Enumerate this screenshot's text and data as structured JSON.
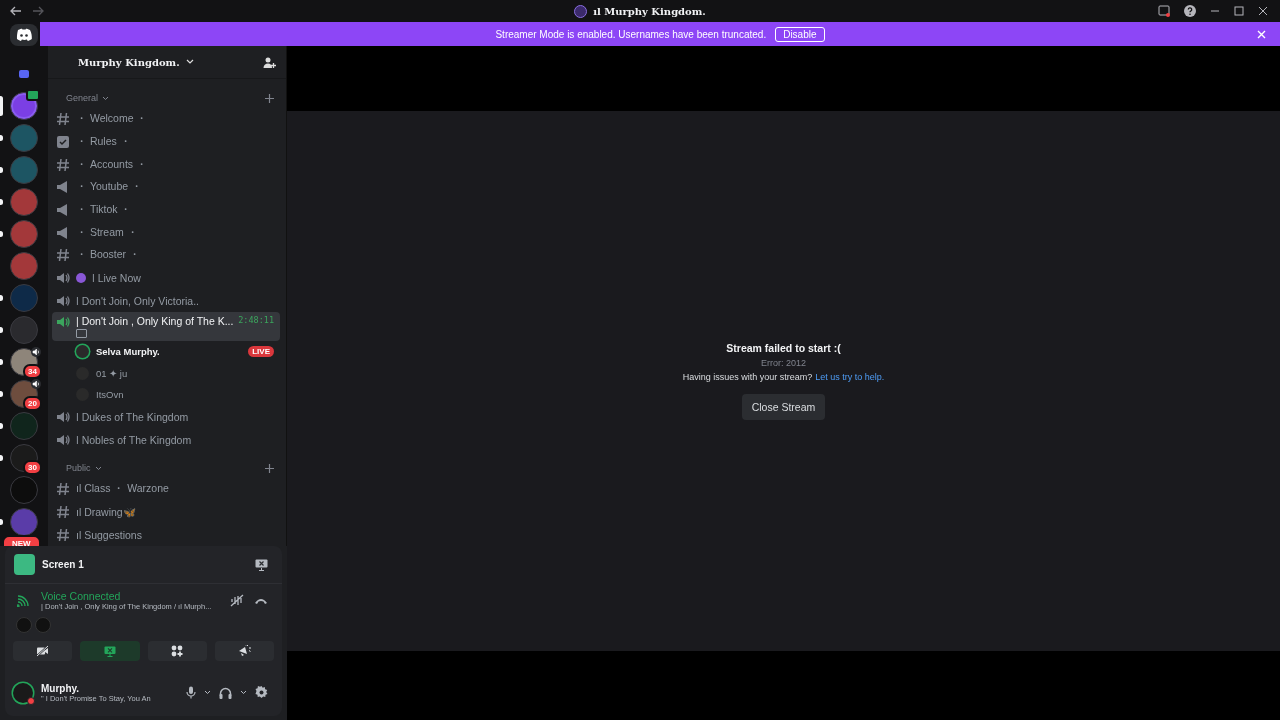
{
  "titlebar": {
    "title": "ıl Murphy Kingdom."
  },
  "banner": {
    "text": "Streamer Mode is enabled. Usernames have been truncated.",
    "button": "Disable"
  },
  "servers": [
    {
      "color": "#7b3fe4",
      "selected": true,
      "chat_badge": true
    },
    {
      "color": "#1d5563",
      "selected": false,
      "unread": true
    },
    {
      "color": "#1d5563",
      "selected": false,
      "unread": true
    },
    {
      "color": "#a3383a",
      "selected": false,
      "unread": true
    },
    {
      "color": "#a3383a",
      "selected": false,
      "unread": true
    },
    {
      "color": "#a3383a",
      "selected": false
    },
    {
      "color": "#0e2a48",
      "selected": false,
      "unread": true
    },
    {
      "color": "#2a2a2e",
      "selected": false,
      "unread": true
    },
    {
      "color": "#8e857a",
      "selected": false,
      "unread": true,
      "speaker": true,
      "badge": "34"
    },
    {
      "color": "#6e4d3e",
      "selected": false,
      "unread": true,
      "speaker": true,
      "badge": "20"
    },
    {
      "color": "#10251c",
      "selected": false,
      "unread": true
    },
    {
      "color": "#1b1b1b",
      "selected": false,
      "unread": true,
      "badge": "30"
    },
    {
      "color": "#0d0d0d",
      "selected": false
    },
    {
      "color": "#5a3ca8",
      "selected": false,
      "unread": true,
      "badge": "NEW"
    }
  ],
  "server_name": "Murphy Kingdom.",
  "categories": [
    {
      "name": "General",
      "channels": [
        {
          "kind": "text",
          "name": "・ Welcome ・",
          "selected": false
        },
        {
          "kind": "rules",
          "name": "・ Rules ・",
          "selected": false
        },
        {
          "kind": "text",
          "name": "・ Accounts ・",
          "selected": false
        },
        {
          "kind": "announcement",
          "name": "・ Youtube ・",
          "selected": false
        },
        {
          "kind": "announcement",
          "name": "・ Tiktok ・",
          "selected": false
        },
        {
          "kind": "announcement",
          "name": "・ Stream ・",
          "selected": false
        },
        {
          "kind": "text",
          "name": "・ Booster ・",
          "selected": false
        },
        {
          "kind": "voice",
          "name": "ǀ Live Now",
          "selected": false,
          "dot": true
        },
        {
          "kind": "voice",
          "name": "ǀ Don't Join, Only Victoria..",
          "selected": false
        },
        {
          "kind": "voice",
          "name": "| Don't Join , Only King of The K...",
          "selected": true,
          "timer": "2:48:11",
          "members": [
            {
              "name": "Selva Murphy.",
              "badge": "LIVE"
            },
            {
              "name": "01 ✦ ju"
            },
            {
              "name": "ItsOvn"
            }
          ]
        },
        {
          "kind": "voice",
          "name": "ǀ Dukes of The Kingdom",
          "selected": false
        },
        {
          "kind": "voice",
          "name": "ǀ Nobles of The Kingdom",
          "selected": false
        }
      ]
    },
    {
      "name": "Public",
      "channels": [
        {
          "kind": "text",
          "name": "ıl Class ・ Warzone",
          "selected": false
        },
        {
          "kind": "text",
          "name": "ıl Drawing🦋",
          "selected": false
        },
        {
          "kind": "text",
          "name": "ıl Suggestions",
          "selected": false
        }
      ]
    }
  ],
  "panel": {
    "stream": "Screen 1",
    "voice_status": "Voice Connected",
    "voice_channel": "| Don't Join , Only King of The Kingdom /  ıl Murph...",
    "buttons": [
      {
        "kind": "camera",
        "selected": false
      },
      {
        "kind": "screen",
        "selected": true
      },
      {
        "kind": "activity",
        "selected": false
      },
      {
        "kind": "soundboard",
        "selected": false
      }
    ],
    "user": "Murphy.",
    "user_status": "\" I Don't Promise To Stay, You An"
  },
  "stream": {
    "title": "Stream failed to start :(",
    "error": "Error: 2012",
    "help": "Having issues with your stream?",
    "link": "Let us try to help.",
    "button": "Close Stream"
  }
}
